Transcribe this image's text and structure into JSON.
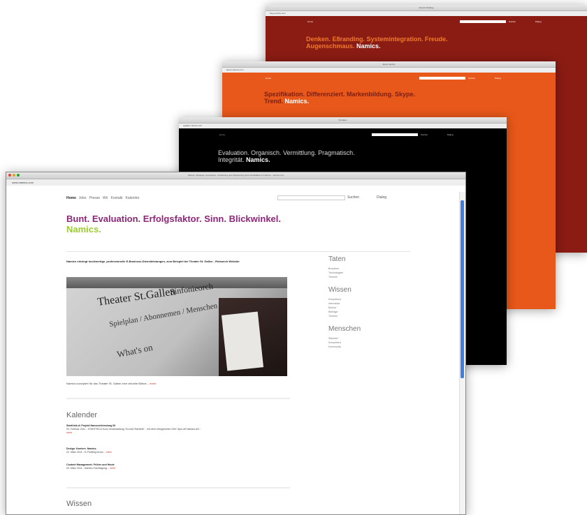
{
  "window1": {
    "title": "Namics Weblog",
    "url": "blog.namics.com",
    "nav_home": "Home",
    "search_label": "Suchen",
    "dialog_label": "Dialog",
    "hero_text": "Denken. E8randing. Systemintegration. Freude. Augenschmaus.",
    "hero_brand": "Namics."
  },
  "window2": {
    "title": "about namics",
    "url": "about.namics.com",
    "nav_home": "Home",
    "search_label": "Suchen",
    "dialog_label": "Dialog",
    "hero_text": "Spezifikation. Differenziert. Markenbildung. Skype. Trend.",
    "hero_brand": "Namics."
  },
  "window3": {
    "title": "St.Galen",
    "url": "stgallen.namics.com",
    "nav_home": "Home",
    "search_label": "Suchen",
    "dialog_label": "Dialog",
    "hero_text": "Evaluation. Organisch. Vermittlung. Pragmatisch. Integrität.",
    "hero_brand": "Namics."
  },
  "window4": {
    "title": "Namics: Strategie, Konzeption, Umsetzung und Optimierung Ihres Geschäftes im Internet - namics.com",
    "url": "www.namics.com",
    "nav": [
      "Home",
      "Jobs",
      "Presse",
      "Wir",
      "Kontakt",
      "Kalender"
    ],
    "search_label": "Suchen",
    "dialog_label": "Dialog",
    "hero_text": "Bunt. Evaluation. Erfolgsfaktor. Sinn. Blickwinkel.",
    "hero_brand": "Namics.",
    "intro": "Namics erbringt hochwertige, professionelle E-Business-Dienstleistungen, zum Beispiel bei Theater St. Gallen - Relaunch Website",
    "photo": {
      "theater": "Theater St.Gallen",
      "sinfonie": "Sinfonieorch",
      "menu": "Spielplan / Abonnemen / Menschen / Haus",
      "whats_on": "What's on"
    },
    "caption": "Namics konzipiert für das Theater St. Gallen eine virtuelle Bühne...",
    "caption_more": "mehr",
    "calendar_heading": "Kalender",
    "calendar": [
      {
        "title": "StartUnit.ch Projekt Nanoorchhestung 06",
        "date": "03. Februar 2011 - STARTFELD Kurz-Veranstaltung \"Du bist Startfeld\" - mit dem erfolgreichen KKK Spin-off Namics AG...",
        "more": "mehr"
      },
      {
        "title": "Design. Karriere. Namics.",
        "date": "22. März 2011 - E-Profiling bruno...",
        "more": "mehr"
      },
      {
        "title": "Content Management: Früher und Heute",
        "date": "03. März 2011 - Namics Fachtagung...",
        "more": "mehr"
      }
    ],
    "wissen_heading": "Wissen",
    "sidebar": [
      {
        "heading": "Taten",
        "items": [
          "Branchen",
          "Technologien",
          "Themen"
        ]
      },
      {
        "heading": "Wissen",
        "items": [
          "Kompetenz",
          "Interviews",
          "Bücher",
          "Beiträge",
          "Themen"
        ]
      },
      {
        "heading": "Menschen",
        "items": [
          "Standort",
          "Kompetenz",
          "Kommunity"
        ]
      }
    ]
  },
  "colors": {
    "red": "#8b1c14",
    "orange": "#e8581a",
    "black": "#000000",
    "purple": "#8b2778",
    "green": "#9ccd2e"
  }
}
